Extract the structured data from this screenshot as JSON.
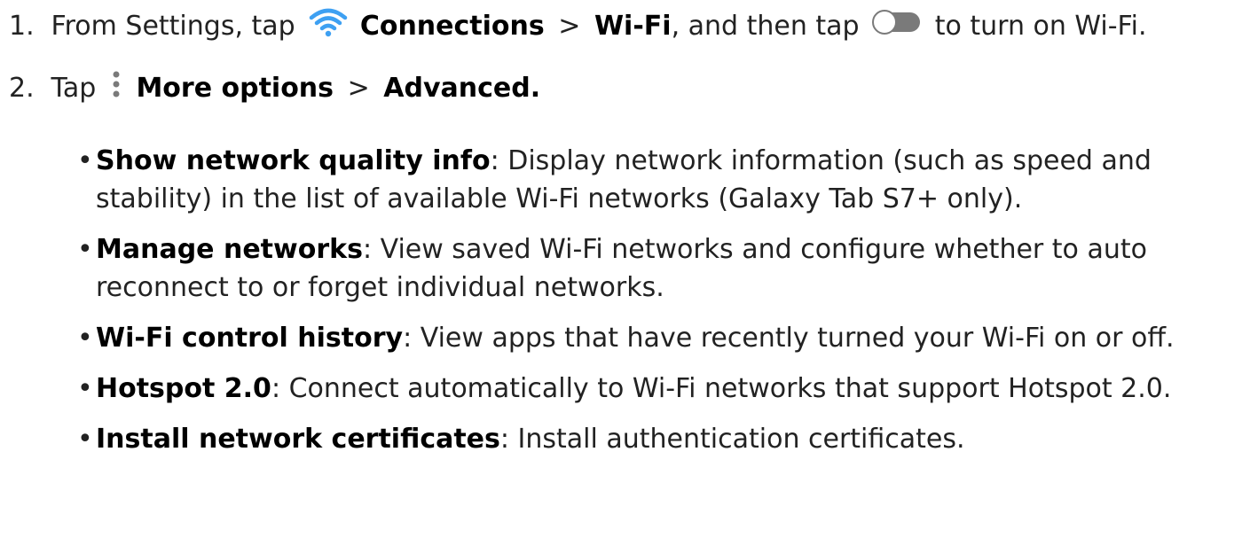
{
  "steps": [
    {
      "number": "1.",
      "prefix": "From Settings, tap",
      "item1": "Connections",
      "separator": ">",
      "item2": "Wi-Fi",
      "middle": ", and then tap",
      "suffix": "to turn on Wi-Fi.",
      "wifi_icon": "wifi-icon",
      "toggle_icon": "toggle-switch-icon"
    },
    {
      "number": "2.",
      "prefix": "Tap",
      "item1": "More options",
      "separator": ">",
      "item2": "Advanced.",
      "menu_icon": "more-options-icon"
    }
  ],
  "options": [
    {
      "term": "Show network quality info",
      "desc": ": Display network information (such as speed and stability) in the list of available Wi-Fi networks (Galaxy Tab S7+ only)."
    },
    {
      "term": "Manage networks",
      "desc": ": View saved Wi-Fi networks and configure whether to auto reconnect to or forget individual networks."
    },
    {
      "term": "Wi-Fi control history",
      "desc": ": View apps that have recently turned your Wi-Fi on or off."
    },
    {
      "term": "Hotspot 2.0",
      "desc": ": Connect automatically to Wi-Fi networks that support Hotspot 2.0."
    },
    {
      "term": "Install network certificates",
      "desc": ": Install authentication certificates."
    }
  ],
  "colors": {
    "wifi_icon": "#3ea0f2",
    "toggle_track": "#7a7a7a",
    "text": "#222222"
  }
}
